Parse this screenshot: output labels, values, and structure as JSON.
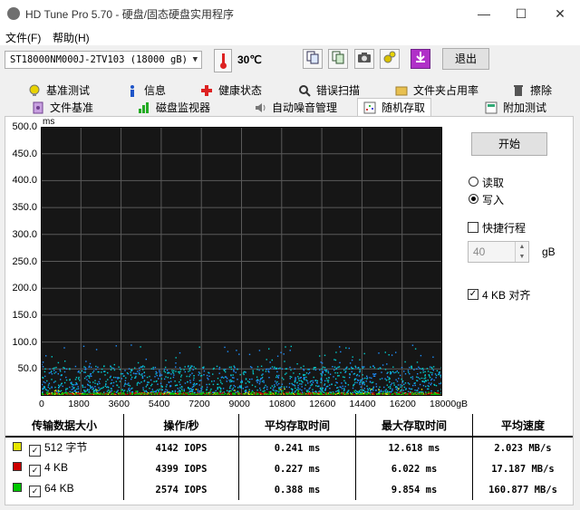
{
  "window": {
    "title": "HD Tune Pro 5.70 - 硬盘/固态硬盘实用程序",
    "minimize": "—",
    "maximize": "☐",
    "close": "✕"
  },
  "menu": {
    "file": "文件(F)",
    "help": "帮助(H)"
  },
  "toolbar": {
    "drive": "ST18000NM000J-2TV103 (18000 gB)",
    "temperature": "30℃",
    "exit": "退出",
    "icons": [
      "copy-info-icon",
      "copy-screenshot-icon",
      "camera-icon",
      "settings-icon",
      "save-icon"
    ]
  },
  "tabs_row1": [
    {
      "label": "基准测试",
      "icon": "benchmark-icon"
    },
    {
      "label": "信息",
      "icon": "info-icon"
    },
    {
      "label": "健康状态",
      "icon": "health-icon"
    },
    {
      "label": "错误扫描",
      "icon": "error-scan-icon"
    },
    {
      "label": "文件夹占用率",
      "icon": "folder-usage-icon"
    },
    {
      "label": "擦除",
      "icon": "erase-icon"
    }
  ],
  "tabs_row2": [
    {
      "label": "文件基准",
      "icon": "file-benchmark-icon"
    },
    {
      "label": "磁盘监视器",
      "icon": "disk-monitor-icon"
    },
    {
      "label": "自动噪音管理",
      "icon": "speaker-icon"
    },
    {
      "label": "随机存取",
      "icon": "random-access-icon",
      "active": true
    },
    {
      "label": "附加测试",
      "icon": "extra-tests-icon"
    }
  ],
  "controls": {
    "start": "开始",
    "read": "读取",
    "write": "写入",
    "selected_mode": "write",
    "quick_stroke": "快捷行程",
    "quick_stroke_checked": false,
    "stroke_value": "40",
    "stroke_unit": "gB",
    "align_4kb": "4 KB 对齐",
    "align_4kb_checked": true
  },
  "chart_data": {
    "type": "scatter",
    "ylabel": "ms",
    "ylim": [
      0,
      500
    ],
    "xlim": [
      0,
      18000
    ],
    "y_ticks": [
      "500.0",
      "450.0",
      "400.0",
      "350.0",
      "300.0",
      "250.0",
      "200.0",
      "150.0",
      "100.0",
      "50.0"
    ],
    "x_ticks": [
      "0",
      "1800",
      "3600",
      "5400",
      "7200",
      "9000",
      "10800",
      "12600",
      "14400",
      "16200",
      "18000gB"
    ],
    "background": "#161616",
    "grid_color": "#5a5a5a",
    "series": [
      {
        "name": "512 字节",
        "color": "#e6e600",
        "typical_ms": [
          0,
          5
        ],
        "max_ms": 12.618
      },
      {
        "name": "4 KB",
        "color": "#cc0000",
        "typical_ms": [
          0,
          5
        ],
        "max_ms": 6.022
      },
      {
        "name": "64 KB",
        "color": "#00c800",
        "typical_ms": [
          0,
          5
        ],
        "max_ms": 9.854
      },
      {
        "color": "#1e90ff",
        "typical_ms": [
          5,
          55
        ],
        "max_ms": 95
      },
      {
        "color": "#00cccc",
        "typical_ms": [
          5,
          55
        ],
        "max_ms": 95
      }
    ]
  },
  "results": {
    "headers": [
      "传输数据大小",
      "操作/秒",
      "平均存取时间",
      "最大存取时间",
      "平均速度"
    ],
    "rows": [
      {
        "size": "512 字节",
        "color": "#e6e600",
        "checked": true,
        "ops": "4142 IOPS",
        "avg": "0.241 ms",
        "max": "12.618 ms",
        "speed": "2.023 MB/s"
      },
      {
        "size": "4 KB",
        "color": "#cc0000",
        "checked": true,
        "ops": "4399 IOPS",
        "avg": "0.227 ms",
        "max": "6.022 ms",
        "speed": "17.187 MB/s"
      },
      {
        "size": "64 KB",
        "color": "#00c800",
        "checked": true,
        "ops": "2574 IOPS",
        "avg": "0.388 ms",
        "max": "9.854 ms",
        "speed": "160.877 MB/s"
      }
    ]
  }
}
